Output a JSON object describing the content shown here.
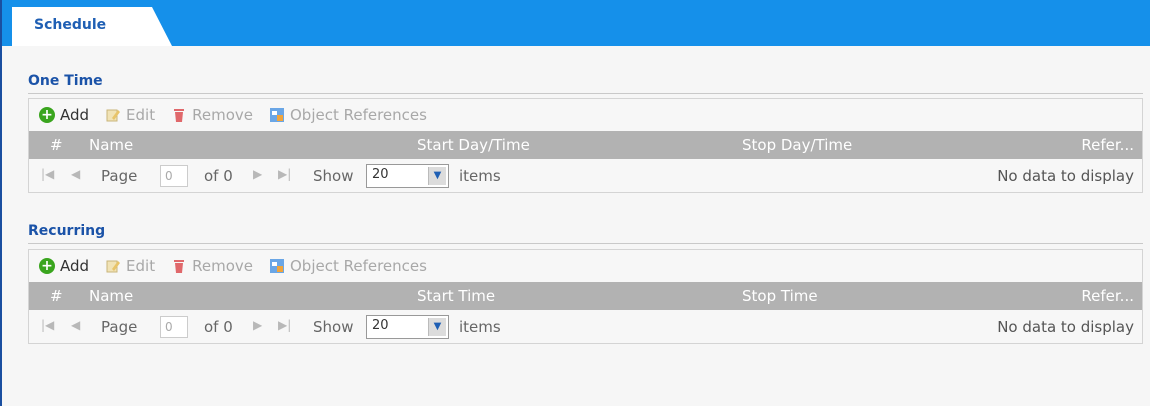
{
  "tab": {
    "label": "Schedule"
  },
  "one_time": {
    "title": "One Time",
    "toolbar": {
      "add": "Add",
      "edit": "Edit",
      "remove": "Remove",
      "refs": "Object References"
    },
    "columns": {
      "num": "#",
      "name": "Name",
      "start": "Start Day/Time",
      "stop": "Stop Day/Time",
      "refer": "Refer..."
    },
    "pager": {
      "page_label": "Page",
      "page_value": "0",
      "of_label": "of 0",
      "show_label": "Show",
      "show_value": "20",
      "items_label": "items",
      "status": "No data to display"
    }
  },
  "recurring": {
    "title": "Recurring",
    "toolbar": {
      "add": "Add",
      "edit": "Edit",
      "remove": "Remove",
      "refs": "Object References"
    },
    "columns": {
      "num": "#",
      "name": "Name",
      "start": "Start Time",
      "stop": "Stop Time",
      "refer": "Refer..."
    },
    "pager": {
      "page_label": "Page",
      "page_value": "0",
      "of_label": "of 0",
      "show_label": "Show",
      "show_value": "20",
      "items_label": "items",
      "status": "No data to display"
    }
  },
  "icons": {
    "add": "plus-circle-icon",
    "edit": "pencil-icon",
    "remove": "trash-icon",
    "refs": "object-references-icon",
    "first": "first-page-icon",
    "prev": "prev-page-icon",
    "next": "next-page-icon",
    "last": "last-page-icon",
    "dropdown": "chevron-down-icon"
  },
  "colors": {
    "topbar": "#1590ea",
    "tab_text": "#1f5fb4",
    "title": "#1b53a8",
    "header_bg": "#b2b2b2",
    "add_green": "#3aa51e",
    "remove_red": "#e0686b"
  }
}
